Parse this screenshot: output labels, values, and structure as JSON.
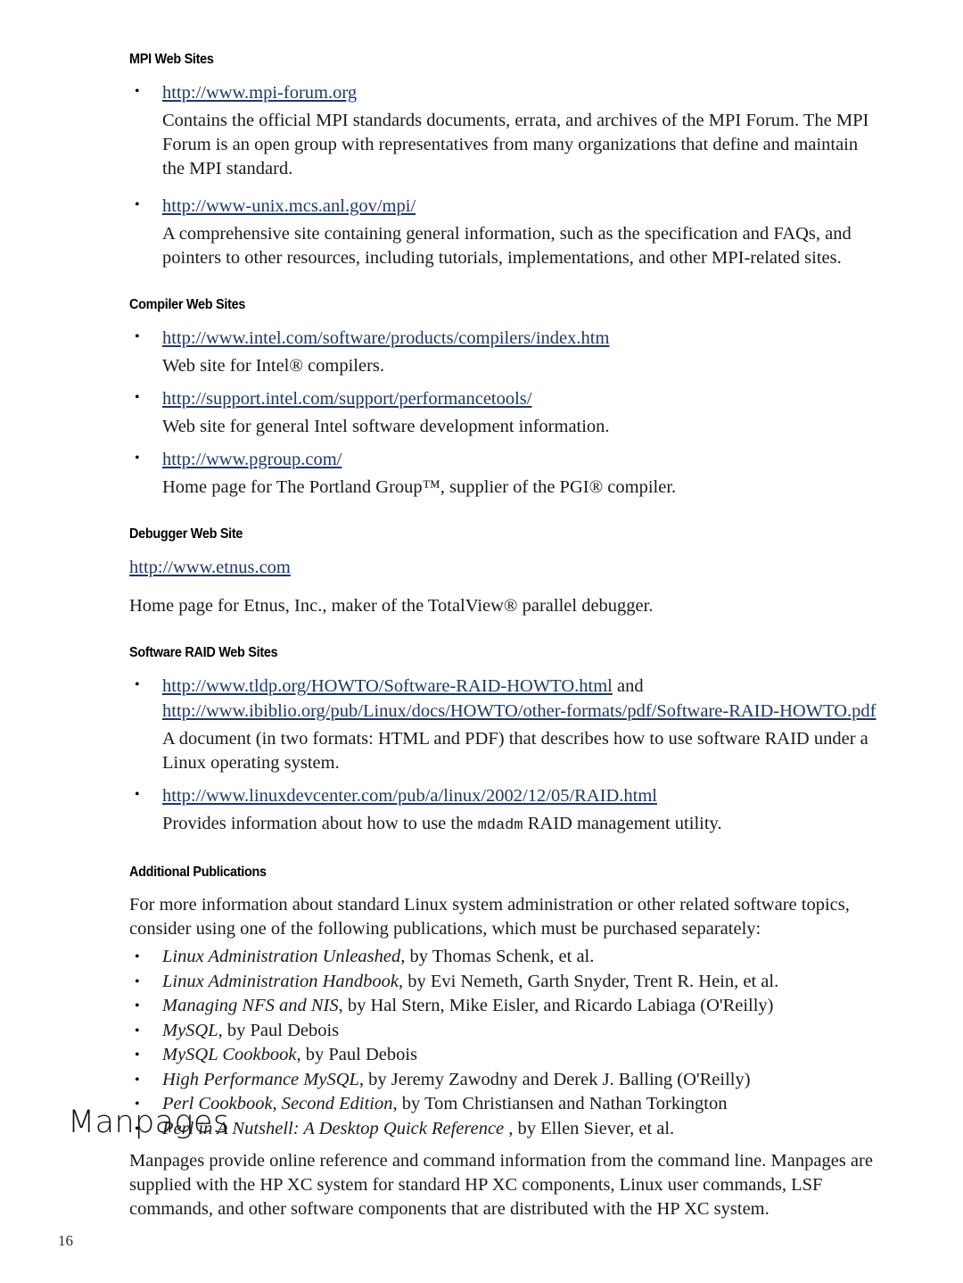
{
  "page": {
    "number": "16"
  },
  "sections": [
    {
      "heading": "MPI Web Sites",
      "items": [
        {
          "url": "http://www.mpi-forum.org",
          "description": "Contains the official MPI standards documents, errata, and archives of the MPI Forum. The MPI Forum is an open group with representatives from many organizations that define and maintain the MPI standard."
        },
        {
          "url": "http://www-unix.mcs.anl.gov/mpi/",
          "description": "A comprehensive site containing general information, such as the specification and FAQs, and pointers to other resources, including tutorials, implementations, and other MPI-related sites."
        }
      ]
    },
    {
      "heading": "Compiler Web Sites",
      "items": [
        {
          "url": "http://www.intel.com/software/products/compilers/index.htm",
          "description": "Web site for Intel® compilers."
        },
        {
          "url": "http://support.intel.com/support/performancetools/",
          "description": "Web site for general Intel software development information."
        },
        {
          "url": "http://www.pgroup.com/",
          "description": "Home page for The Portland Group™, supplier of the PGI® compiler."
        }
      ]
    },
    {
      "heading": "Debugger Web Site",
      "url": "http://www.etnus.com",
      "description": "Home page for Etnus, Inc., maker of the TotalView® parallel debugger."
    },
    {
      "heading": "Software RAID Web Sites",
      "items": [
        {
          "url": "http://www.tldp.org/HOWTO/Software-RAID-HOWTO.html",
          "conjunction": " and ",
          "url2": "http://www.ibiblio.org/pub/Linux/docs/HOWTO/other-formats/pdf/Software-RAID-HOWTO.pdf",
          "description": "A document (in two formats: HTML and PDF) that describes how to use software RAID under a Linux operating system."
        },
        {
          "url": "http://www.linuxdevcenter.com/pub/a/linux/2002/12/05/RAID.html",
          "description_pre": "Provides information about how to use the ",
          "description_code": "mdadm",
          "description_post": " RAID management utility."
        }
      ]
    },
    {
      "heading": "Additional Publications",
      "intro": "For more information about standard Linux system administration or other related software topics, consider using one of the following publications, which must be purchased separately:",
      "publications": [
        {
          "title": "Linux Administration Unleashed",
          "rest": ", by Thomas Schenk, et al."
        },
        {
          "title": "Linux Administration Handbook",
          "rest": ", by Evi Nemeth, Garth Snyder, Trent R. Hein, et al."
        },
        {
          "title": "Managing NFS and NIS",
          "rest": ", by Hal Stern, Mike Eisler, and Ricardo Labiaga (O'Reilly)"
        },
        {
          "title": "MySQL",
          "rest": ", by Paul Debois"
        },
        {
          "title": "MySQL Cookbook",
          "rest": ", by Paul Debois"
        },
        {
          "title": "High Performance MySQL",
          "rest": ", by Jeremy Zawodny and Derek J. Balling (O'Reilly)"
        },
        {
          "title": "Perl Cookbook, Second Edition",
          "rest": ", by Tom Christiansen and Nathan Torkington"
        },
        {
          "title": "Perl in A Nutshell: A Desktop Quick Reference ",
          "rest": ", by Ellen Siever, et al."
        }
      ]
    }
  ],
  "chapter": {
    "title": "Manpages",
    "body": "Manpages provide online reference and command information from the command line. Manpages are supplied with the HP XC system for standard HP XC components, Linux user commands, LSF commands, and other software components that are distributed with the HP XC system."
  },
  "colors": {
    "link": "#1f3864",
    "text": "#1a1a1a",
    "background": "#ffffff"
  }
}
